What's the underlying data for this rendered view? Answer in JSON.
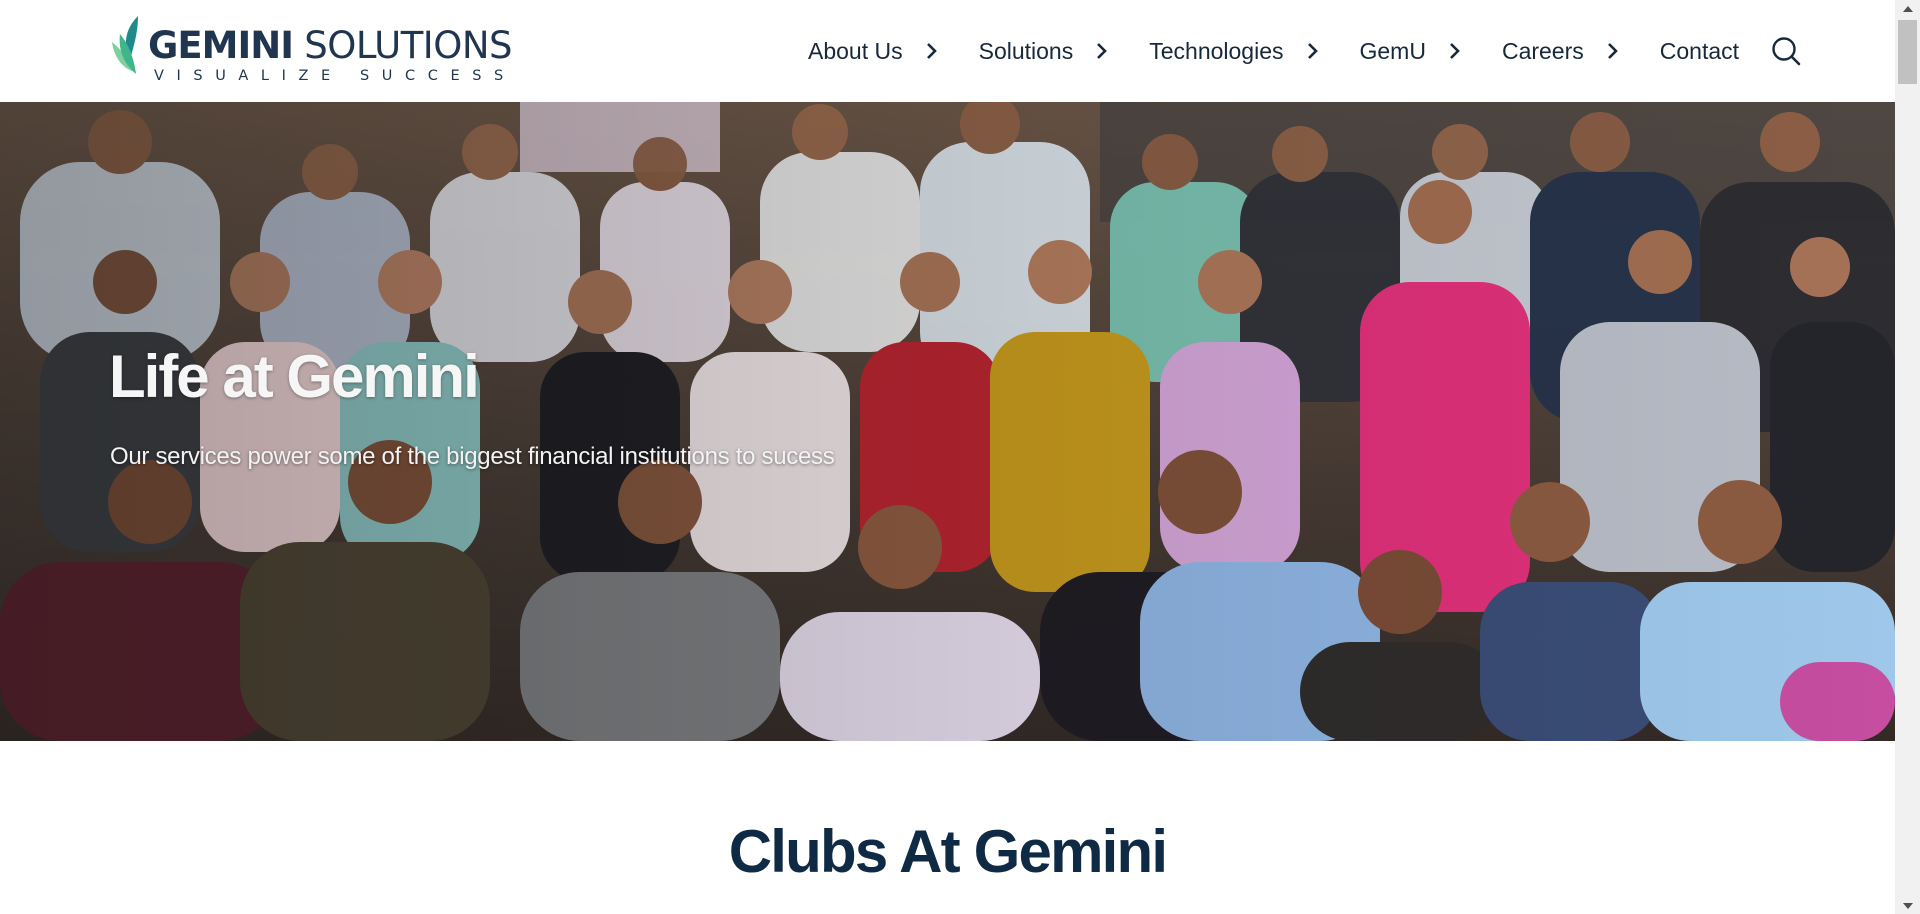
{
  "brand": {
    "name_bold": "GEMINI",
    "name_rest": " SOLUTIONS",
    "tagline": "VISUALIZE SUCCESS",
    "colors": {
      "navy": "#1f3550",
      "leaf_green": "#3fb58a",
      "leaf_teal": "#1f8a8a"
    }
  },
  "nav": {
    "items": [
      {
        "label": "About Us",
        "icon": "chevron-right-icon"
      },
      {
        "label": "Solutions",
        "icon": "chevron-right-icon"
      },
      {
        "label": "Technologies",
        "icon": "chevron-right-icon"
      },
      {
        "label": "GemU",
        "icon": "chevron-right-icon"
      },
      {
        "label": "Careers",
        "icon": "chevron-right-icon"
      },
      {
        "label": "Contact"
      }
    ],
    "search_icon": "search-icon"
  },
  "hero": {
    "title": "Life at Gemini",
    "subtitle": "Our services power some of the biggest financial institutions to sucess"
  },
  "clubs": {
    "title": "Clubs At Gemini"
  }
}
